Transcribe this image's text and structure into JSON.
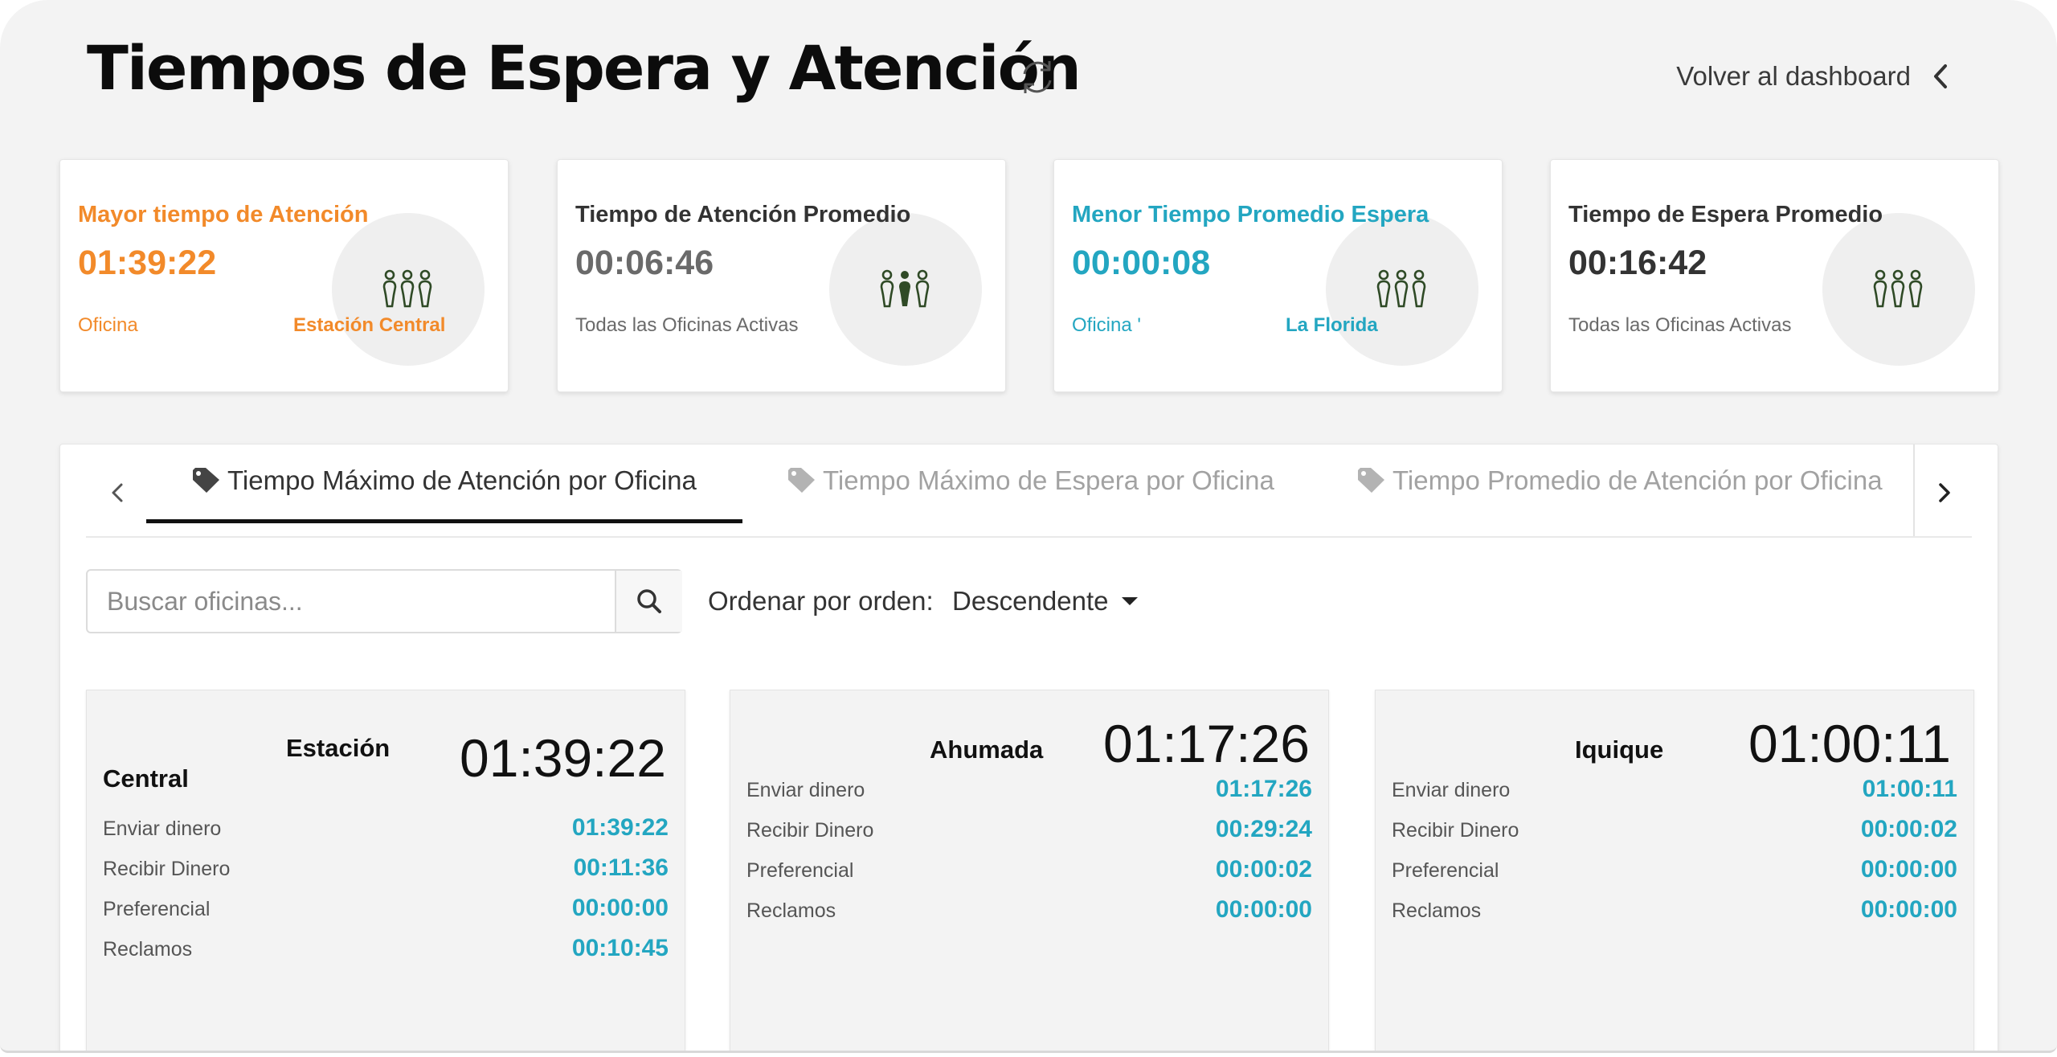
{
  "header": {
    "title": "Tiempos de Espera y Atención",
    "back_label": "Volver al dashboard"
  },
  "colors": {
    "orange": "#f28a2a",
    "teal": "#23a6c1",
    "dark": "#333333",
    "icon_green": "#2f4a26"
  },
  "kpis": [
    {
      "title": "Mayor tiempo de Atención",
      "value": "01:39:22",
      "sub_left": "Oficina",
      "sub_right": "Estación Central",
      "accent": "orange",
      "icon": "people-group-icon"
    },
    {
      "title": "Tiempo de Atención Promedio",
      "value": "00:06:46",
      "sub_left": "Todas las Oficinas Activas",
      "sub_right": "",
      "accent": "dark",
      "icon": "people-group-icon"
    },
    {
      "title": "Menor Tiempo Promedio Espera",
      "value": "00:00:08",
      "sub_left": "Oficina '",
      "sub_right": "La Florida",
      "accent": "teal",
      "icon": "people-group-icon"
    },
    {
      "title": "Tiempo de Espera Promedio",
      "value": "00:16:42",
      "sub_left": "Todas las Oficinas Activas",
      "sub_right": "",
      "accent": "dark",
      "icon": "people-group-icon"
    }
  ],
  "tabs": [
    {
      "label": "Tiempo Máximo de Atención por Oficina",
      "active": true
    },
    {
      "label": "Tiempo Máximo de Espera por Oficina",
      "active": false
    },
    {
      "label": "Tiempo Promedio de Atención por Oficina",
      "active": false
    }
  ],
  "search": {
    "placeholder": "Buscar oficinas...",
    "value": ""
  },
  "sort": {
    "label": "Ordenar por orden:",
    "selected": "Descendente"
  },
  "offices": [
    {
      "name_line1": "Estación",
      "name_line2": "Central",
      "total": "01:39:22",
      "rows": [
        {
          "label": "Enviar dinero",
          "value": "01:39:22"
        },
        {
          "label": "Recibir Dinero",
          "value": "00:11:36"
        },
        {
          "label": "Preferencial",
          "value": "00:00:00"
        },
        {
          "label": "Reclamos",
          "value": "00:10:45"
        }
      ]
    },
    {
      "name_line1": "Ahumada",
      "name_line2": "",
      "total": "01:17:26",
      "rows": [
        {
          "label": "Enviar dinero",
          "value": "01:17:26"
        },
        {
          "label": "Recibir Dinero",
          "value": "00:29:24"
        },
        {
          "label": "Preferencial",
          "value": "00:00:02"
        },
        {
          "label": "Reclamos",
          "value": "00:00:00"
        }
      ]
    },
    {
      "name_line1": "Iquique",
      "name_line2": "",
      "total": "01:00:11",
      "rows": [
        {
          "label": "Enviar dinero",
          "value": "01:00:11"
        },
        {
          "label": "Recibir Dinero",
          "value": "00:00:02"
        },
        {
          "label": "Preferencial",
          "value": "00:00:00"
        },
        {
          "label": "Reclamos",
          "value": "00:00:00"
        }
      ]
    }
  ]
}
